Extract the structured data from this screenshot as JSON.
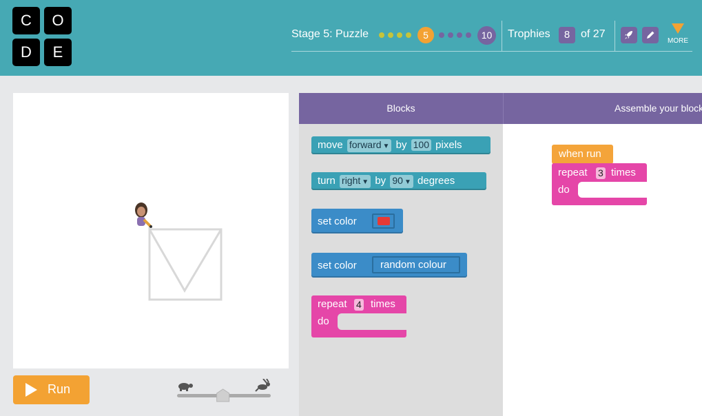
{
  "logo": {
    "letters": [
      "C",
      "O",
      "D",
      "E"
    ]
  },
  "header": {
    "stage_label": "Stage 5: Puzzle",
    "current_puzzle": "5",
    "last_puzzle": "10",
    "trophies_label": "Trophies",
    "trophies_count": "8",
    "trophies_total": "of 27",
    "more_label": "MORE",
    "colors": {
      "bar": "#46a9b4",
      "done_dot": "#c6c43a",
      "current": "#f3a233",
      "pending_dot": "#7665a0"
    }
  },
  "controls": {
    "run_label": "Run",
    "slow_icon": "turtle-icon",
    "fast_icon": "rabbit-icon",
    "speed": 0.49
  },
  "panels": {
    "blocks_title": "Blocks",
    "workspace_title": "Assemble your blocks here"
  },
  "toolbox": {
    "move": {
      "label": "move",
      "direction": "forward",
      "by": "by",
      "amount": "100",
      "unit": "pixels"
    },
    "turn": {
      "label": "turn",
      "direction": "right",
      "by": "by",
      "amount": "90",
      "unit": "degrees"
    },
    "set_color_swatch": {
      "label": "set color",
      "swatch_color": "#e63a36"
    },
    "set_color_random": {
      "label": "set color",
      "value": "random colour"
    },
    "repeat": {
      "label": "repeat",
      "count": "4",
      "suffix": "times",
      "do_label": "do"
    }
  },
  "workspace": {
    "when_run": "when run",
    "repeat": {
      "label": "repeat",
      "count": "3",
      "suffix": "times",
      "do_label": "do"
    }
  }
}
